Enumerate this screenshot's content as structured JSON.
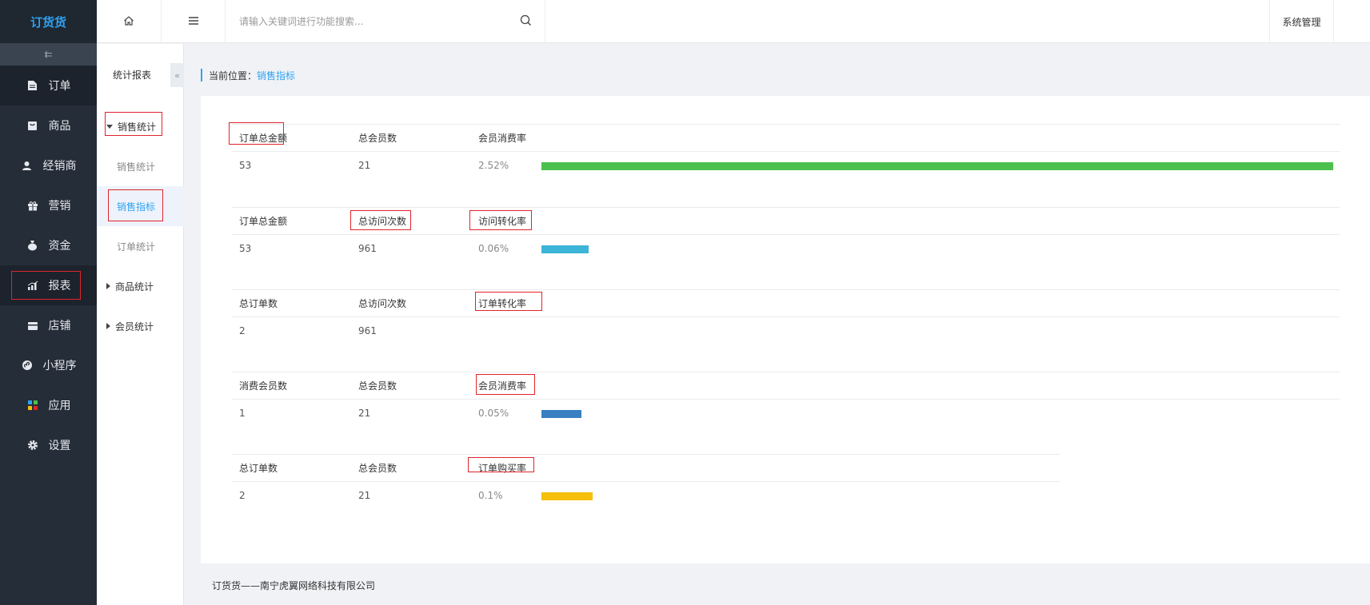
{
  "app": {
    "logo": "订货货"
  },
  "sidebar": {
    "items": [
      {
        "label": "订单",
        "icon": "document-icon"
      },
      {
        "label": "商品",
        "icon": "goods-icon"
      },
      {
        "label": "经销商",
        "icon": "user-icon"
      },
      {
        "label": "营销",
        "icon": "gift-icon"
      },
      {
        "label": "资金",
        "icon": "money-bag-icon"
      },
      {
        "label": "报表",
        "icon": "bar-chart-icon"
      },
      {
        "label": "店铺",
        "icon": "store-icon"
      },
      {
        "label": "小程序",
        "icon": "mini-program-icon"
      },
      {
        "label": "应用",
        "icon": "apps-icon"
      },
      {
        "label": "设置",
        "icon": "gear-icon"
      }
    ]
  },
  "topbar": {
    "search_placeholder": "请输入关键词进行功能搜索...",
    "system_label": "系统管理"
  },
  "subnav": {
    "title": "统计报表",
    "groups": [
      {
        "label": "销售统计",
        "expanded": true,
        "children": [
          "销售统计",
          "销售指标",
          "订单统计"
        ]
      },
      {
        "label": "商品统计",
        "expanded": false
      },
      {
        "label": "会员统计",
        "expanded": false
      }
    ]
  },
  "breadcrumb": {
    "prefix": "当前位置：",
    "current": "销售指标"
  },
  "metrics": [
    {
      "headers": [
        "订单总金额",
        "总会员数",
        "会员消费率"
      ],
      "values": [
        "53",
        "21",
        "2.52%"
      ],
      "bar_fraction": 1.0,
      "bar_color": "#4cc04f"
    },
    {
      "headers": [
        "订单总金额",
        "总访问次数",
        "访问转化率"
      ],
      "values": [
        "53",
        "961",
        "0.06%"
      ],
      "bar_fraction": 0.06,
      "bar_color": "#3cb5d8"
    },
    {
      "headers": [
        "总订单数",
        "总访问次数",
        "订单转化率"
      ],
      "values": [
        "2",
        "961",
        ""
      ],
      "bar_fraction": 0,
      "bar_color": "#2ea3f2"
    },
    {
      "headers": [
        "消费会员数",
        "总会员数",
        "会员消费率"
      ],
      "values": [
        "1",
        "21",
        "0.05%"
      ],
      "bar_fraction": 0.05,
      "bar_color": "#3a7fc1"
    },
    {
      "headers": [
        "总订单数",
        "总会员数",
        "订单购买率"
      ],
      "values": [
        "2",
        "21",
        "0.1%"
      ],
      "bar_fraction": 0.065,
      "bar_color": "#f5bf0a"
    }
  ],
  "footer": {
    "text": "订货货——南宁虎翼网络科技有限公司"
  }
}
